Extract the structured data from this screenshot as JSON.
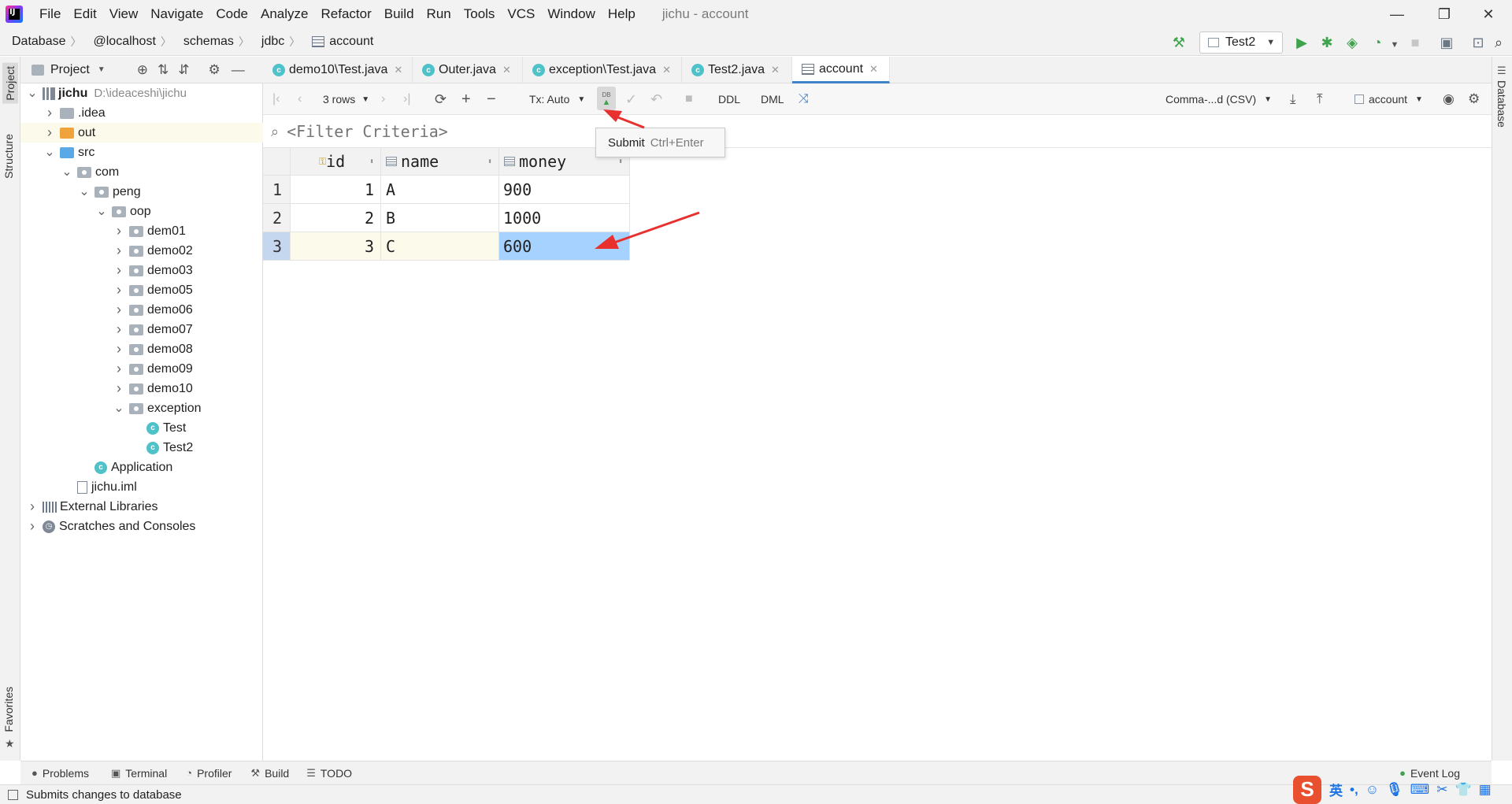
{
  "app": {
    "window_title": "jichu - account",
    "logo_text": "IJ"
  },
  "menu": [
    "File",
    "Edit",
    "View",
    "Navigate",
    "Code",
    "Analyze",
    "Refactor",
    "Build",
    "Run",
    "Tools",
    "VCS",
    "Window",
    "Help"
  ],
  "window_controls": {
    "minimize": "—",
    "restore": "❐",
    "close": "✕"
  },
  "breadcrumb": [
    "Database",
    "@localhost",
    "schemas",
    "jdbc",
    "account"
  ],
  "run_config": {
    "label": "Test2"
  },
  "side_tabs": {
    "project": "Project",
    "structure": "Structure",
    "favorites": "Favorites",
    "database": "Database"
  },
  "project_panel": {
    "title": "Project",
    "tree": [
      {
        "label": "jichu",
        "path": "D:\\ideaceshi\\jichu",
        "level": 0,
        "arrow": "open",
        "icon": "module"
      },
      {
        "label": ".idea",
        "level": 1,
        "arrow": "closed",
        "icon": "folder-gray"
      },
      {
        "label": "out",
        "level": 1,
        "arrow": "closed",
        "icon": "folder-orange",
        "highlight": true
      },
      {
        "label": "src",
        "level": 1,
        "arrow": "open",
        "icon": "folder-blue"
      },
      {
        "label": "com",
        "level": 2,
        "arrow": "open",
        "icon": "package"
      },
      {
        "label": "peng",
        "level": 3,
        "arrow": "open",
        "icon": "package"
      },
      {
        "label": "oop",
        "level": 4,
        "arrow": "open",
        "icon": "package"
      },
      {
        "label": "dem01",
        "level": 5,
        "arrow": "closed",
        "icon": "package"
      },
      {
        "label": "demo02",
        "level": 5,
        "arrow": "closed",
        "icon": "package"
      },
      {
        "label": "demo03",
        "level": 5,
        "arrow": "closed",
        "icon": "package"
      },
      {
        "label": "demo05",
        "level": 5,
        "arrow": "closed",
        "icon": "package"
      },
      {
        "label": "demo06",
        "level": 5,
        "arrow": "closed",
        "icon": "package"
      },
      {
        "label": "demo07",
        "level": 5,
        "arrow": "closed",
        "icon": "package"
      },
      {
        "label": "demo08",
        "level": 5,
        "arrow": "closed",
        "icon": "package"
      },
      {
        "label": "demo09",
        "level": 5,
        "arrow": "closed",
        "icon": "package"
      },
      {
        "label": "demo10",
        "level": 5,
        "arrow": "closed",
        "icon": "package"
      },
      {
        "label": "exception",
        "level": 5,
        "arrow": "open",
        "icon": "package"
      },
      {
        "label": "Test",
        "level": 6,
        "arrow": "none",
        "icon": "class"
      },
      {
        "label": "Test2",
        "level": 6,
        "arrow": "none",
        "icon": "class"
      },
      {
        "label": "Application",
        "level": 3,
        "arrow": "none",
        "icon": "class"
      },
      {
        "label": "jichu.iml",
        "level": 2,
        "arrow": "none",
        "icon": "file"
      },
      {
        "label": "External Libraries",
        "level": 0,
        "arrow": "closed",
        "icon": "library"
      },
      {
        "label": "Scratches and Consoles",
        "level": 0,
        "arrow": "closed",
        "icon": "scratch"
      }
    ]
  },
  "editor_tabs": [
    {
      "label": "demo10\\Test.java",
      "active": false
    },
    {
      "label": "Outer.java",
      "active": false
    },
    {
      "label": "exception\\Test.java",
      "active": false
    },
    {
      "label": "Test2.java",
      "active": false
    },
    {
      "label": "account",
      "active": true
    }
  ],
  "data_toolbar": {
    "rows_label": "3 rows",
    "tx_label": "Tx: Auto",
    "submit_badge": "DB",
    "ddl": "DDL",
    "dml": "DML",
    "export_format": "Comma-...d (CSV)",
    "datasource": "account"
  },
  "filter": {
    "placeholder": "<Filter Criteria>"
  },
  "tooltip": {
    "label": "Submit",
    "shortcut": "Ctrl+Enter"
  },
  "table": {
    "columns": [
      "id",
      "name",
      "money"
    ],
    "rows": [
      {
        "num": "1",
        "id": "1",
        "name": "A",
        "money": "900"
      },
      {
        "num": "2",
        "id": "2",
        "name": "B",
        "money": "1000"
      },
      {
        "num": "3",
        "id": "3",
        "name": "C",
        "money": "600"
      }
    ],
    "selected_row": 3,
    "selected_column": "money"
  },
  "bottom_tabs": [
    "Problems",
    "Terminal",
    "Profiler",
    "Build",
    "TODO"
  ],
  "event_log": "Event Log",
  "status_text": "Submits changes to database",
  "ime": {
    "logo": "S",
    "mode": "英"
  },
  "colors": {
    "accent": "#4083c9",
    "selection": "#a6d2ff",
    "arrow_annotation": "#e8312f",
    "run_green": "#3fa34d"
  }
}
